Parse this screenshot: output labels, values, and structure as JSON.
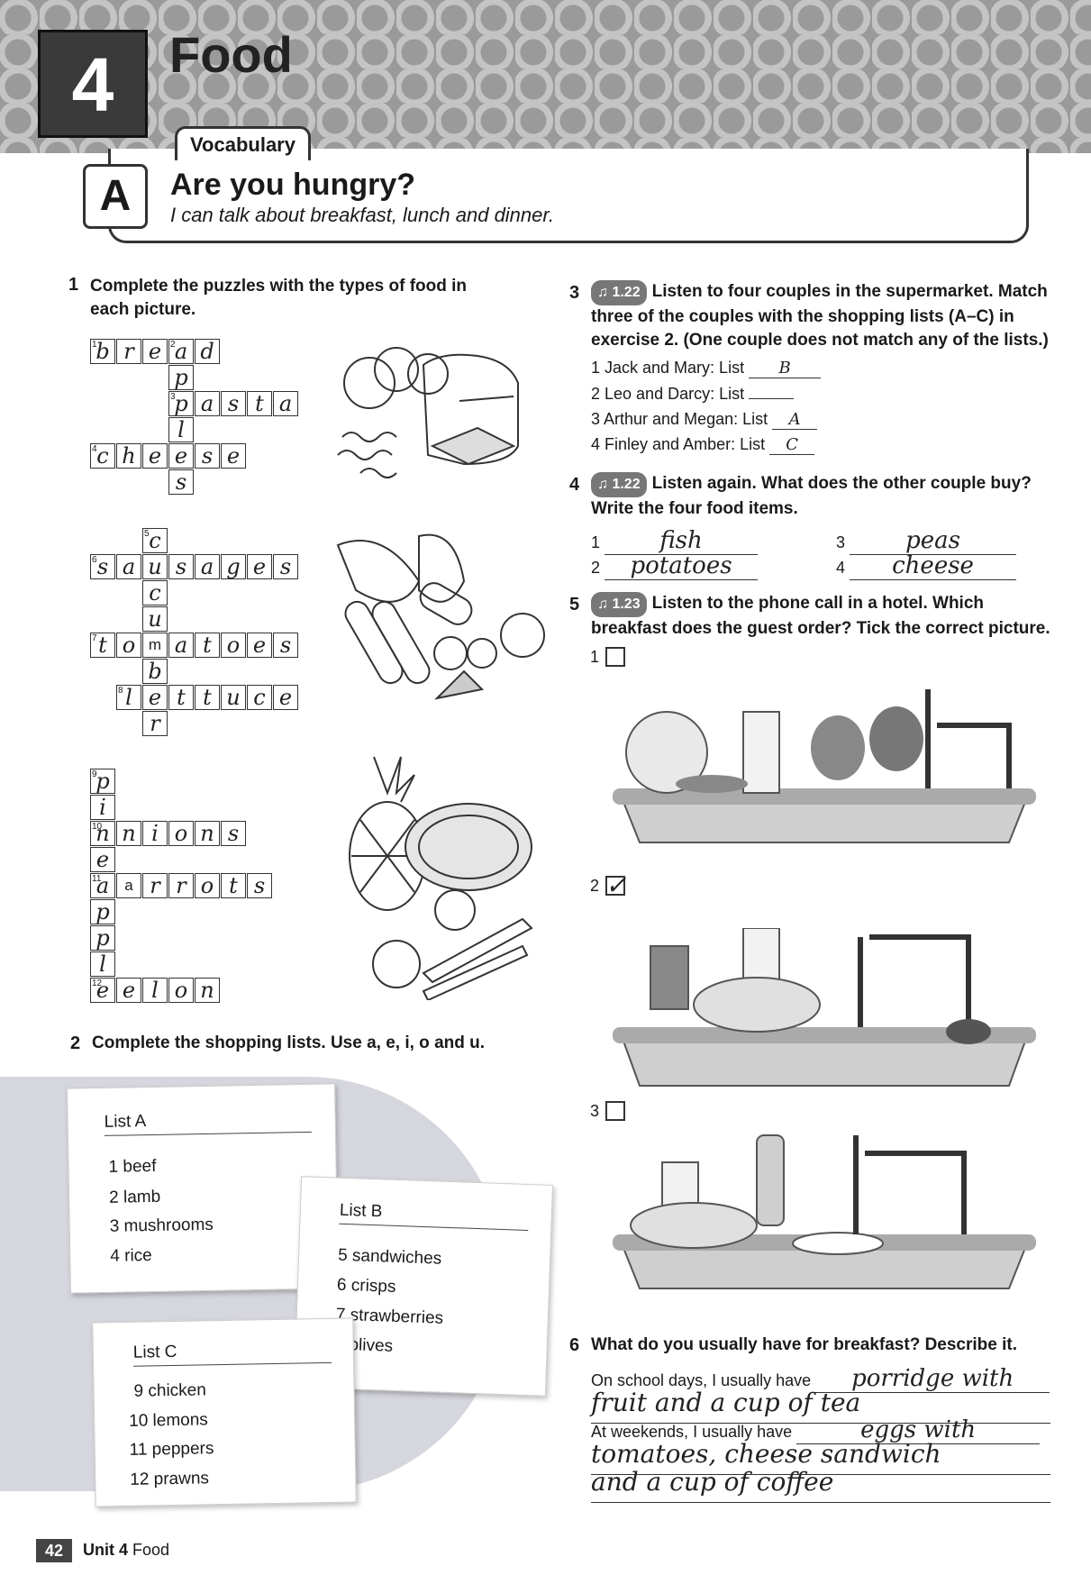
{
  "header": {
    "unit_number": "4",
    "unit_title": "Food",
    "section_tab": "Vocabulary",
    "lesson_letter": "A",
    "lesson_title": "Are you hungry?",
    "lesson_subtitle": "I can talk about breakfast, lunch and dinner."
  },
  "ex1": {
    "num": "1",
    "instruction": "Complete the puzzles with the types of food in each picture.",
    "puzzle1": {
      "bread": [
        "b",
        "r",
        "e",
        "a",
        "d"
      ],
      "apples_rest": [
        "p",
        "p",
        "l",
        "e",
        "s"
      ],
      "pasta": [
        "p",
        "a",
        "s",
        "t",
        "a"
      ],
      "cheese": [
        "c",
        "h",
        "e",
        "e",
        "s",
        "e"
      ]
    },
    "puzzle2": {
      "sausages": [
        "s",
        "a",
        "u",
        "s",
        "a",
        "g",
        "e",
        "s"
      ],
      "cucumber": [
        "c",
        "u",
        "c",
        "u",
        "m",
        "b",
        "e",
        "r"
      ],
      "tomatoes": [
        "t",
        "o",
        "m",
        "a",
        "t",
        "o",
        "e",
        "s"
      ],
      "lettuce": [
        "l",
        "e",
        "t",
        "t",
        "u",
        "c",
        "e"
      ]
    },
    "puzzle3": {
      "pineapple": [
        "p",
        "i",
        "n",
        "e",
        "a",
        "p",
        "p",
        "l",
        "e"
      ],
      "onions": [
        "o",
        "n",
        "i",
        "o",
        "n",
        "s"
      ],
      "carrots": [
        "c",
        "a",
        "r",
        "r",
        "o",
        "t",
        "s"
      ],
      "melon": [
        "m",
        "e",
        "l",
        "o",
        "n"
      ]
    },
    "numbers": [
      "1",
      "2",
      "3",
      "4",
      "5",
      "6",
      "7",
      "8",
      "9",
      "10",
      "11",
      "12"
    ]
  },
  "ex2": {
    "num": "2",
    "instruction": "Complete the shopping lists. Use a, e, i, o and u.",
    "listA": {
      "title": "List A",
      "items": [
        "1  beef",
        "2  lamb",
        "3  mushrooms",
        "4  rice"
      ]
    },
    "listB": {
      "title": "List B",
      "items": [
        "5  sandwiches",
        "6  crisps",
        "7  strawberries",
        "8  olives"
      ]
    },
    "listC": {
      "title": "List C",
      "items": [
        "9  chicken",
        "10  lemons",
        "11  peppers",
        "12  prawns"
      ]
    }
  },
  "ex3": {
    "num": "3",
    "audio": "1.22",
    "instruction": "Listen to four couples in the supermarket. Match three of the couples with the shopping lists (A–C) in exercise 2. (One couple does not match any of the lists.)",
    "items": [
      {
        "label": "1  Jack and Mary: List",
        "answer": "B"
      },
      {
        "label": "2  Leo and Darcy: List",
        "answer": ""
      },
      {
        "label": "3  Arthur and Megan: List",
        "answer": "A"
      },
      {
        "label": "4  Finley and Amber: List",
        "answer": "C"
      }
    ]
  },
  "ex4": {
    "num": "4",
    "audio": "1.22",
    "instruction": "Listen again. What does the other couple buy? Write the four food items.",
    "items": [
      {
        "n": "1",
        "answer": "fish"
      },
      {
        "n": "2",
        "answer": "potatoes"
      },
      {
        "n": "3",
        "answer": "peas"
      },
      {
        "n": "4",
        "answer": "cheese"
      }
    ]
  },
  "ex5": {
    "num": "5",
    "audio": "1.23",
    "instruction": "Listen to the phone call in a hotel. Which breakfast does the guest order? Tick the correct picture.",
    "options": [
      "1",
      "2",
      "3"
    ],
    "tick": "✓"
  },
  "ex6": {
    "num": "6",
    "instruction": "What do you usually have for breakfast? Describe it.",
    "prompt1": "On school days, I usually have",
    "answer1a": "porridge with",
    "answer1b": "fruit and a cup of tea",
    "prompt2": "At weekends, I usually have",
    "answer2a": "eggs with",
    "answer2b": "tomatoes, cheese sandwich",
    "answer2c": "and a cup of coffee"
  },
  "footer": {
    "page": "42",
    "unit": "Unit 4",
    "title": "Food"
  }
}
